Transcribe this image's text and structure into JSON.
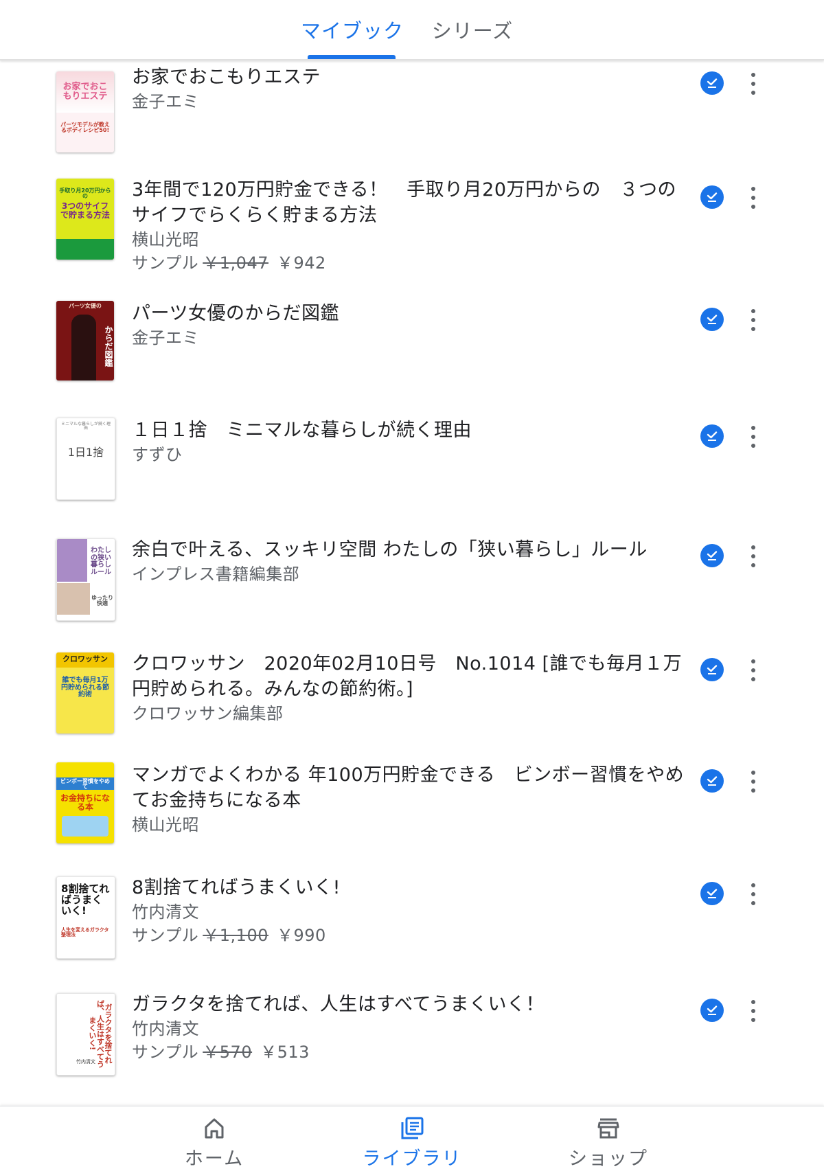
{
  "tabs": {
    "mybook": "マイブック",
    "series": "シリーズ"
  },
  "books": [
    {
      "title": "お家でおこもりエステ",
      "author": "金子エミ",
      "cover_text": "お家でおこもりエステ",
      "cover_sub": "パーツモデルが教えるボディレシピ50!"
    },
    {
      "title": "3年間で120万円貯金できる！　手取り月20万円からの　３つのサイフでらくらく貯まる方法",
      "author": "横山光昭",
      "sample_label": "サンプル",
      "price_original": "￥1,047",
      "price_sale": "￥942",
      "cover_text": "3つのサイフで貯まる方法",
      "cover_sub": "手取り月20万円からの"
    },
    {
      "title": "パーツ女優のからだ図鑑",
      "author": "金子エミ",
      "cover_text": "からだ図鑑",
      "cover_sub": "パーツ女優の"
    },
    {
      "title": "１日１捨　ミニマルな暮らしが続く理由",
      "author": "すずひ",
      "cover_text": "1日1捨",
      "cover_sub": "ミニマルな暮らしが続く理由"
    },
    {
      "title": "余白で叶える、スッキリ空間 わたしの「狭い暮らし」ルール",
      "author": "インプレス書籍編集部",
      "cover_text": "わたしの狭い暮らしルール",
      "cover_sub": "ゆったり快適"
    },
    {
      "title": "クロワッサン　2020年02月10日号　No.1014 [誰でも毎月１万円貯められる。みんなの節約術。]",
      "author": "クロワッサン編集部",
      "cover_text": "クロワッサン",
      "cover_sub": "誰でも毎月1万円貯められる節約術"
    },
    {
      "title": "マンガでよくわかる 年100万円貯金できる　ビンボー習慣をやめてお金持ちになる本",
      "author": "横山光昭",
      "cover_text": "お金持ちになる本",
      "cover_sub": "ビンボー習慣をやめて"
    },
    {
      "title": "8割捨てればうまくいく!",
      "author": "竹内清文",
      "sample_label": "サンプル",
      "price_original": "￥1,100",
      "price_sale": "￥990",
      "cover_text": "8割捨てればうまくいく!",
      "cover_sub": "人生を変えるガラクタ整理法"
    },
    {
      "title": "ガラクタを捨てれば、人生はすべてうまくいく！",
      "author": "竹内清文",
      "sample_label": "サンプル",
      "price_original": "￥570",
      "price_sale": "￥513",
      "cover_text": "ガラクタを捨てれば、人生はすべてうまくいく!",
      "cover_sub": "竹内清文"
    }
  ],
  "bottom_nav": {
    "home": "ホーム",
    "library": "ライブラリ",
    "shop": "ショップ"
  },
  "colors": {
    "accent": "#1a73e8",
    "text_primary": "#202124",
    "text_secondary": "#5f6368"
  },
  "icons": {
    "downloaded": "check-circle-icon",
    "menu": "more-vertical-icon",
    "home": "home-icon",
    "library": "library-books-icon",
    "shop": "storefront-icon"
  }
}
